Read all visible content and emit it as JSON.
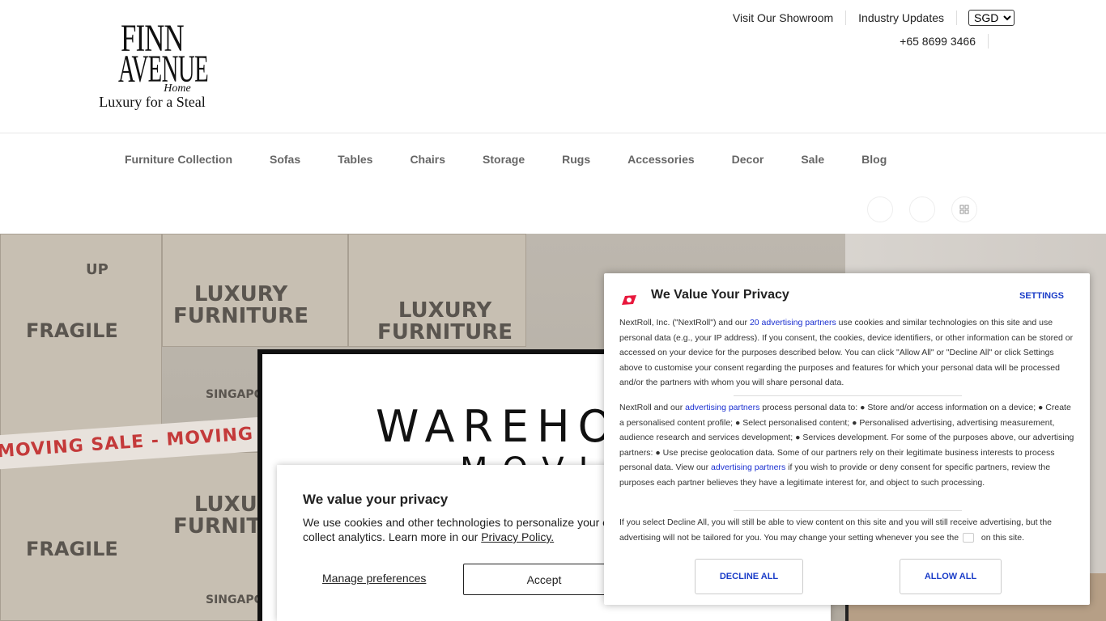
{
  "header": {
    "logo": {
      "line1": "FINN",
      "line2": "AVENUE",
      "line3": "Home",
      "tagline": "Luxury for a Steal"
    },
    "top_links": [
      "Visit Our Showroom",
      "Industry Updates"
    ],
    "currency": "SGD",
    "phone": "+65 8699 3466"
  },
  "nav": {
    "items": [
      "Furniture Collection",
      "Sofas",
      "Tables",
      "Chairs",
      "Storage",
      "Rugs",
      "Accessories",
      "Decor",
      "Sale",
      "Blog"
    ]
  },
  "hero": {
    "box_labels": [
      "LUXURY\nFURNITURE",
      "FRAGILE",
      "LUXURY\nFURNITURE",
      "SINGAPORE",
      "UP"
    ],
    "tape_text": "MOVING SALE - MOVING SALE",
    "sign_line1": "WAREHO",
    "sign_line2": "MOVIN"
  },
  "cookie_banner": {
    "title": "We value your privacy",
    "text": "We use cookies and other technologies to personalize your e",
    "text2": "collect analytics. Learn more in our ",
    "privacy_link": "Privacy Policy.",
    "manage_label": "Manage preferences",
    "accept_label": "Accept"
  },
  "nextroll": {
    "title": "We Value Your Privacy",
    "settings_label": "SETTINGS",
    "p1_a": "NextRoll, Inc. (\"NextRoll\") and our ",
    "p1_link": "20 advertising partners",
    "p1_b": " use cookies and similar technologies on this site and use personal data (e.g., your IP address). If you consent, the cookies, device identifiers, or other information can be stored or accessed on your device for the purposes described below. You can click \"Allow All\" or \"Decline All\" or click Settings above to customise your consent regarding the purposes and features for which your personal data will be processed and/or the partners with whom you will share personal data.",
    "p2_a": "NextRoll and our ",
    "p2_link1": "advertising partners",
    "p2_b": " process personal data to: ● Store and/or access information on a device; ● Create a personalised content profile; ● Select personalised content; ● Personalised advertising, advertising measurement, audience research and services development; ● Services development. For some of the purposes above, our advertising partners: ● Use precise geolocation data. Some of our partners rely on their legitimate business interests to process personal data. View our ",
    "p2_link2": "advertising partners",
    "p2_c": " if you wish to provide or deny consent for specific partners, review the purposes each partner believes they have a legitimate interest for, and object to such processing.",
    "p3_a": "If you select Decline All, you will still be able to view content on this site and you will still receive advertising, but the advertising will not be tailored for you. You may change your setting whenever you see the ",
    "p3_b": " on this site.",
    "decline_label": "DECLINE ALL",
    "allow_label": "ALLOW ALL",
    "brand_color": "#e8173c",
    "link_color": "#1a2fd0"
  }
}
